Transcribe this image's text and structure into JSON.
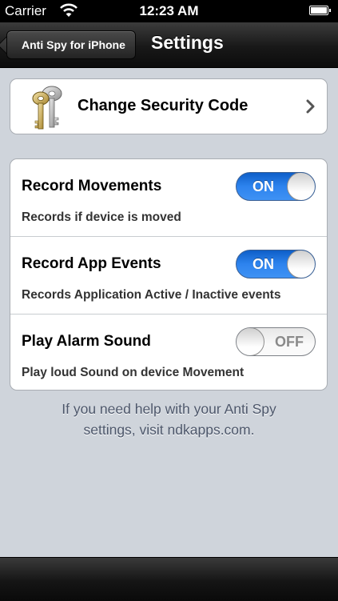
{
  "status_bar": {
    "carrier": "Carrier",
    "time": "12:23 AM"
  },
  "nav": {
    "back_label": "Anti Spy for iPhone",
    "title": "Settings"
  },
  "security": {
    "label": "Change Security Code",
    "icon": "keys-icon"
  },
  "settings": [
    {
      "title": "Record Movements",
      "description": "Records if device is moved",
      "state": "ON"
    },
    {
      "title": "Record App Events",
      "description": "Records Application Active / Inactive events",
      "state": "ON"
    },
    {
      "title": "Play Alarm Sound",
      "description": "Play loud Sound on device Movement",
      "state": "OFF"
    }
  ],
  "help": {
    "line1": "If you need help with your Anti Spy",
    "line2": "settings, visit ndkapps.com."
  },
  "colors": {
    "toggle_on": "#2d83ee",
    "background": "#cfd4db"
  }
}
